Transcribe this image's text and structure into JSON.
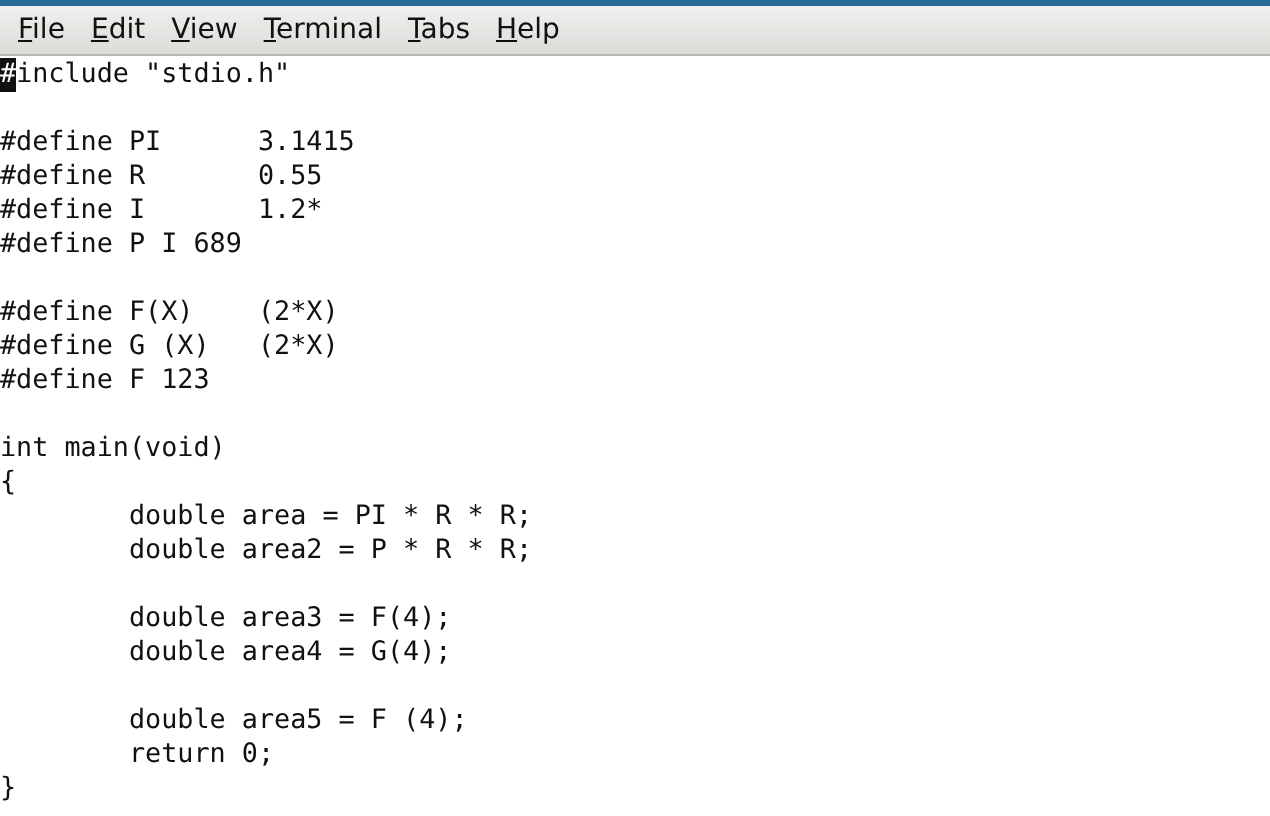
{
  "menu": [
    {
      "label": "File"
    },
    {
      "label": "Edit"
    },
    {
      "label": "View"
    },
    {
      "label": "Terminal"
    },
    {
      "label": "Tabs"
    },
    {
      "label": "Help"
    }
  ],
  "blocks": [
    {
      "lines": [
        {
          "cursor": "#",
          "text": "include \"stdio.h\""
        }
      ]
    },
    {
      "lines": [
        {
          "text": "#define PI      3.1415"
        },
        {
          "text": "#define R       0.55"
        },
        {
          "text": "#define I       1.2*"
        },
        {
          "text": "#define P I 689"
        }
      ]
    },
    {
      "lines": [
        {
          "text": "#define F(X)    (2*X)"
        },
        {
          "text": "#define G (X)   (2*X)"
        },
        {
          "text": "#define F 123"
        }
      ]
    },
    {
      "lines": [
        {
          "text": "int main(void)"
        },
        {
          "text": "{"
        },
        {
          "text": "        double area = PI * R * R;"
        },
        {
          "text": "        double area2 = P * R * R;"
        }
      ]
    },
    {
      "lines": [
        {
          "text": "        double area3 = F(4);"
        },
        {
          "text": "        double area4 = G(4);"
        }
      ]
    },
    {
      "lines": [
        {
          "text": "        double area5 = F (4);"
        },
        {
          "text": "        return 0;"
        },
        {
          "text": "}"
        }
      ]
    }
  ]
}
